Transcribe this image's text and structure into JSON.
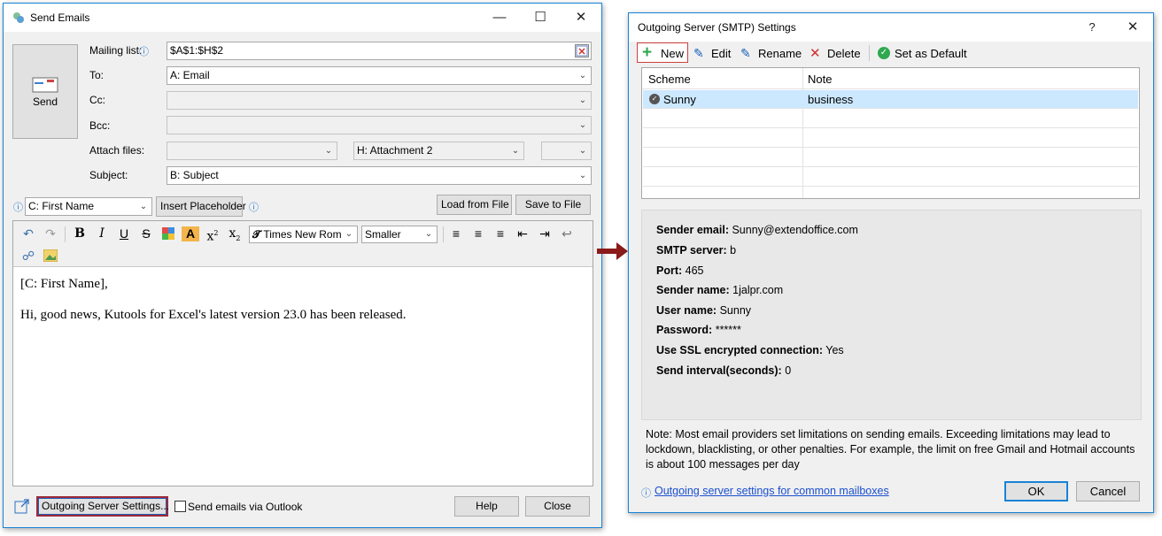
{
  "send_window": {
    "title": "Send Emails",
    "send_button_label": "Send",
    "mailing_list": {
      "label": "Mailing list:",
      "value": "$A$1:$H$2"
    },
    "to": {
      "label": "To:",
      "value": "A: Email"
    },
    "cc": {
      "label": "Cc:",
      "value": ""
    },
    "bcc": {
      "label": "Bcc:",
      "value": ""
    },
    "attach": {
      "label": "Attach files:",
      "value1": "",
      "value2": "H: Attachment 2",
      "value3": ""
    },
    "subject": {
      "label": "Subject:",
      "value": "B: Subject"
    },
    "placeholder_select": "C: First Name",
    "insert_placeholder": "Insert Placeholder",
    "load_from_file": "Load from File",
    "save_to_file": "Save to File",
    "font_name": "Times New Rom",
    "font_size": "Smaller",
    "body_line1": "[C: First Name],",
    "body_line2": "Hi, good news, Kutools for Excel's latest version 23.0 has been released.",
    "outgoing_server_settings": "Outgoing Server Settings...",
    "send_via_outlook": "Send emails via Outlook",
    "help": "Help",
    "close": "Close"
  },
  "smtp_window": {
    "title": "Outgoing Server (SMTP) Settings",
    "help_glyph": "?",
    "toolbar": {
      "new": "New",
      "edit": "Edit",
      "rename": "Rename",
      "delete": "Delete",
      "set_default": "Set as Default"
    },
    "columns": [
      "Scheme",
      "Note"
    ],
    "rows": [
      {
        "scheme": "Sunny",
        "note": "business"
      }
    ],
    "details": {
      "sender_email_label": "Sender email:",
      "sender_email": "Sunny@extendoffice.com",
      "smtp_server_label": "SMTP server:",
      "smtp_server": "b",
      "port_label": "Port:",
      "port": "465",
      "sender_name_label": "Sender name:",
      "sender_name": "1jalpr.com",
      "user_name_label": "User name:",
      "user_name": "Sunny",
      "password_label": "Password:",
      "password": "******",
      "ssl_label": "Use SSL encrypted connection:",
      "ssl": "Yes",
      "interval_label": "Send interval(seconds):",
      "interval": "0"
    },
    "note": "Note: Most email providers set limitations on sending emails. Exceeding limitations may lead to lockdown, blacklisting, or other penalties. For example, the limit on free Gmail and Hotmail accounts is about 100 messages per day",
    "link": "Outgoing server settings for common mailboxes",
    "ok": "OK",
    "cancel": "Cancel"
  },
  "colors": {
    "accent": "#1883d7",
    "arrow": "#8b1a1a",
    "selected_row": "#cce8ff",
    "highlight_box": "#d04040"
  }
}
